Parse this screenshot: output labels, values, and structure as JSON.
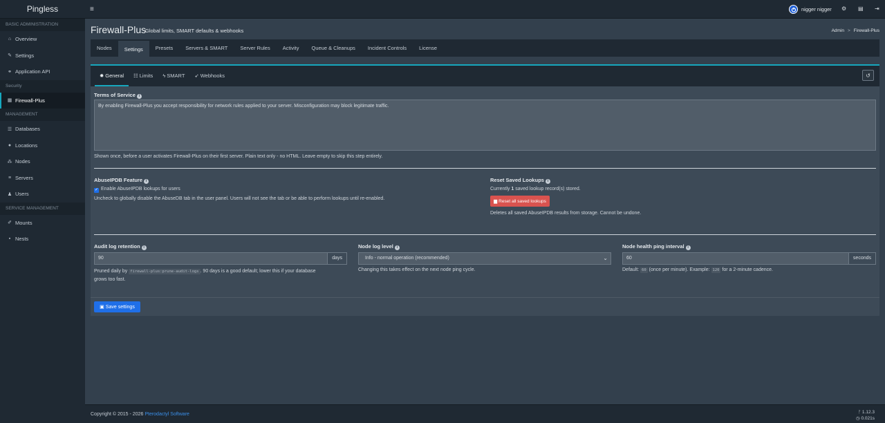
{
  "app": {
    "brand": "Pingless"
  },
  "sidebar": {
    "sections": {
      "basic": "BASIC ADMINISTRATION",
      "security": "Security",
      "management": "MANAGEMENT",
      "service": "SERVICE MANAGEMENT"
    },
    "items": {
      "overview": "Overview",
      "settings": "Settings",
      "api": "Application API",
      "firewall": "Firewall-Plus",
      "databases": "Databases",
      "locations": "Locations",
      "nodes": "Nodes",
      "servers": "Servers",
      "users": "Users",
      "mounts": "Mounts",
      "nests": "Nests"
    }
  },
  "topbar": {
    "username": "nigger nigger"
  },
  "page": {
    "title": "Firewall-Plus",
    "subtitle": "Global limits, SMART defaults & webhooks",
    "breadcrumb": {
      "admin": "Admin",
      "sep": ">",
      "current": "Firewall-Plus"
    }
  },
  "tabs": [
    "Nodes",
    "Settings",
    "Presets",
    "Servers & SMART",
    "Server Rules",
    "Activity",
    "Queue & Cleanups",
    "Incident Controls",
    "License"
  ],
  "subtabs": [
    "General",
    "Limits",
    "SMART",
    "Webhooks"
  ],
  "form": {
    "tos": {
      "label": "Terms of Service",
      "value": "By enabling Firewall-Plus you accept responsibility for network rules applied to your server. Misconfiguration may block legitimate traffic.",
      "help": "Shown once, before a user activates Firewall-Plus on their first server. Plain text only - no HTML. Leave empty to skip this step entirely."
    },
    "abuse": {
      "label": "AbuseIPDB Feature",
      "checkbox": "Enable AbuseIPDB lookups for users",
      "help": "Uncheck to globally disable the AbuseDB tab in the user panel. Users will not see the tab or be able to perform lookups until re-enabled."
    },
    "reset": {
      "label": "Reset Saved Lookups",
      "status_pre": "Currently ",
      "count": "1",
      "status_post": " saved lookup record(s) stored.",
      "button": "Reset all saved lookups",
      "help": "Deletes all saved AbuseIPDB results from storage. Cannot be undone."
    },
    "audit": {
      "label": "Audit log retention",
      "value": "90",
      "unit": "days",
      "help_pre": "Pruned daily by ",
      "help_code": "firewall-plus:prune-audit-logs",
      "help_post": ". 90 days is a good default; lower this if your database",
      "help_line2": "grows too fast."
    },
    "nodelog": {
      "label": "Node log level",
      "value": "Info - normal operation (recommended)",
      "help": "Changing this takes effect on the next node ping cycle."
    },
    "ping": {
      "label": "Node health ping interval",
      "value": "60",
      "unit": "seconds",
      "help_pre": "Default: ",
      "help_code1": "60",
      "help_mid": " (once per minute). Example: ",
      "help_code2": "120",
      "help_post": " for a 2-minute cadence."
    },
    "save": "Save settings"
  },
  "footer": {
    "copyright": "Copyright © 2015 - 2026 ",
    "link": "Pterodactyl Software",
    "version": "1.12.3",
    "time": "0.021s"
  }
}
